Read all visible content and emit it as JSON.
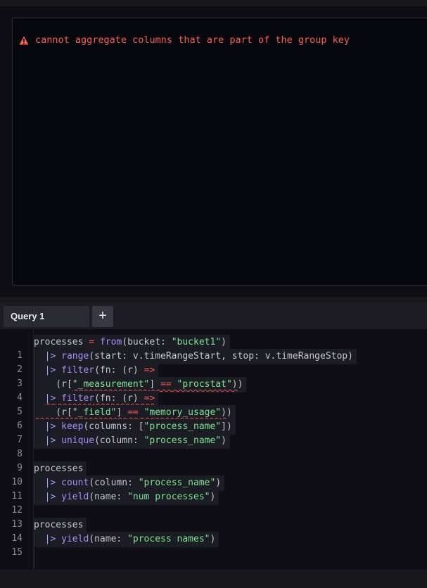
{
  "results": {
    "error_message": "cannot aggregate columns that are part of the group key",
    "error_icon": "warning-triangle-icon"
  },
  "tabs": {
    "items": [
      {
        "label": "Query 1"
      }
    ],
    "add_label": "+"
  },
  "editor": {
    "line_numbers": [
      "1",
      "2",
      "3",
      "4",
      "5",
      "6",
      "7",
      "8",
      "9",
      "10",
      "11",
      "12",
      "13",
      "14",
      "15"
    ]
  },
  "colors": {
    "error": "#f95f53",
    "keyword": "#a98cf6",
    "string": "#7ce490",
    "background": "#0e0e14"
  }
}
